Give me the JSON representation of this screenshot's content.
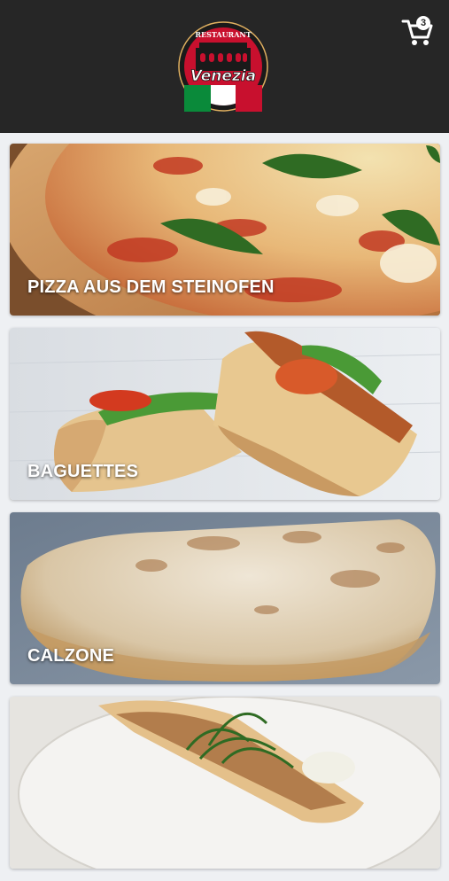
{
  "header": {
    "logo": {
      "top_text": "RESTAURANT",
      "name": "Venezia",
      "colors": {
        "red": "#c8102e",
        "green": "#0a8a3a",
        "white": "#ffffff",
        "dark": "#1a1a1a"
      }
    },
    "cart": {
      "icon": "shopping-cart-icon",
      "count": "3"
    }
  },
  "categories": [
    {
      "label": "PIZZA AUS DEM STEINOFEN",
      "image": "pizza-photo"
    },
    {
      "label": "BAGUETTES",
      "image": "baguette-photo"
    },
    {
      "label": "CALZONE",
      "image": "calzone-photo"
    },
    {
      "label": "",
      "image": "flatbread-salad-photo"
    }
  ]
}
